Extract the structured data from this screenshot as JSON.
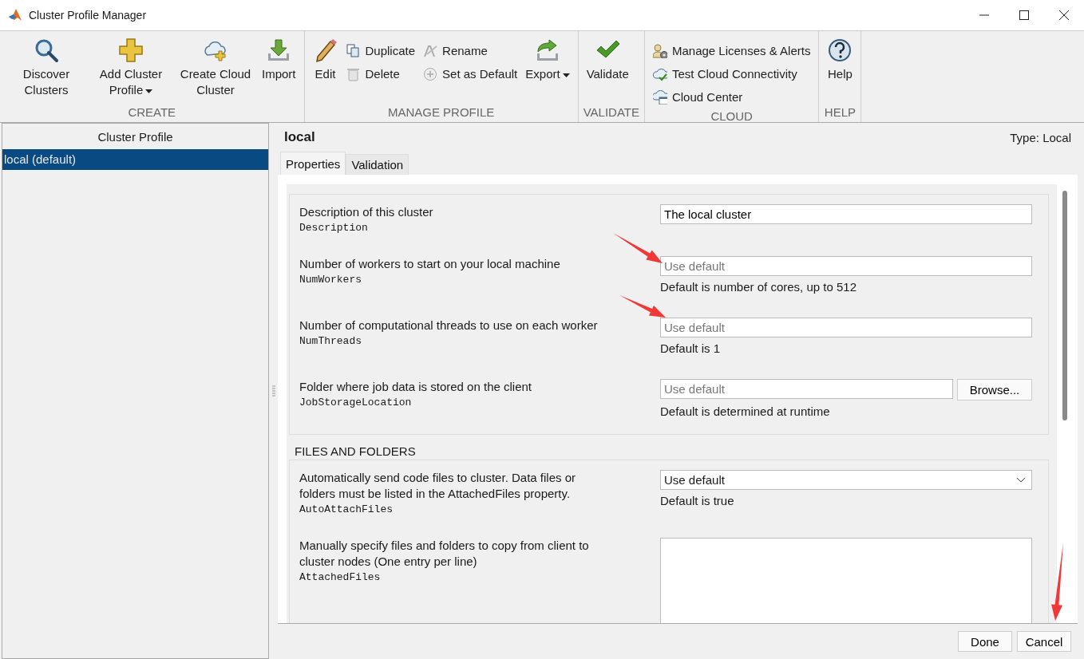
{
  "window": {
    "title": "Cluster Profile Manager"
  },
  "toolstrip": {
    "sections": [
      {
        "label": "CREATE",
        "items": [
          {
            "kind": "large",
            "label": "Discover Clusters"
          },
          {
            "kind": "large",
            "label": "Add Cluster Profile",
            "dropdown": true
          },
          {
            "kind": "large",
            "label": "Create Cloud Cluster"
          },
          {
            "kind": "large",
            "label": "Import"
          }
        ]
      },
      {
        "label": "MANAGE PROFILE",
        "items": [
          {
            "kind": "large",
            "label": "Edit"
          },
          {
            "kind": "stack",
            "items": [
              {
                "label": "Duplicate"
              },
              {
                "label": "Delete"
              }
            ]
          },
          {
            "kind": "stack",
            "items": [
              {
                "label": "Rename"
              },
              {
                "label": "Set as Default"
              }
            ]
          },
          {
            "kind": "large",
            "label": "Export",
            "dropdown": true
          }
        ]
      },
      {
        "label": "VALIDATE",
        "items": [
          {
            "kind": "large",
            "label": "Validate"
          }
        ]
      },
      {
        "label": "CLOUD",
        "items": [
          {
            "kind": "stack",
            "items": [
              {
                "label": "Manage Licenses & Alerts"
              },
              {
                "label": "Test Cloud Connectivity"
              },
              {
                "label": "Cloud Center"
              }
            ]
          }
        ]
      },
      {
        "label": "HELP",
        "items": [
          {
            "kind": "large",
            "label": "Help"
          }
        ]
      }
    ]
  },
  "sidebar": {
    "title": "Cluster Profile",
    "items": [
      {
        "label": "local (default)",
        "selected": true
      }
    ]
  },
  "profile": {
    "name": "local",
    "type": "Type: Local"
  },
  "tabs": [
    {
      "label": "Properties",
      "selected": true
    },
    {
      "label": "Validation",
      "selected": false
    }
  ],
  "groups": [
    {
      "properties": [
        {
          "kind": "text",
          "description": "Description of this cluster",
          "name": "Description",
          "value": "The local cluster"
        },
        {
          "kind": "text",
          "description": "Number of workers to start on your local machine",
          "name": "NumWorkers",
          "placeholder": "Use default",
          "hint": "Default is number of cores, up to 512"
        },
        {
          "kind": "text",
          "description": "Number of computational threads to use on each worker",
          "name": "NumThreads",
          "placeholder": "Use default",
          "hint": "Default is 1"
        },
        {
          "kind": "browse",
          "description": "Folder where job data is stored on the client",
          "name": "JobStorageLocation",
          "placeholder": "Use default",
          "button": "Browse...",
          "hint": "Default is determined at runtime"
        }
      ]
    },
    {
      "title": "FILES AND FOLDERS",
      "properties": [
        {
          "kind": "select",
          "description": "Automatically send code files to cluster. Data files or folders must be listed in the AttachedFiles property.",
          "name": "AutoAttachFiles",
          "value": "Use default",
          "hint": "Default is true"
        },
        {
          "kind": "textarea",
          "description": "Manually specify files and folders to copy from client to cluster nodes (One entry per line)",
          "name": "AttachedFiles"
        }
      ]
    }
  ],
  "buttons": [
    "Done",
    "Cancel"
  ]
}
